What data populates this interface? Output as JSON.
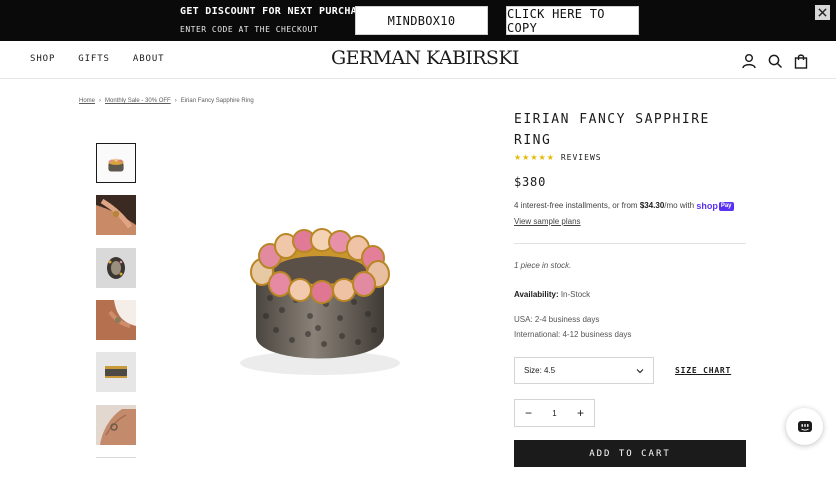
{
  "promo": {
    "title": "GET DISCOUNT FOR NEXT PURCHASE",
    "subtitle": "ENTER CODE AT THE CHECKOUT",
    "code": "MINDBOX10",
    "copy_label": "CLICK HERE TO COPY",
    "close_icon": "close-icon"
  },
  "header": {
    "nav": [
      "SHOP",
      "GIFTS",
      "ABOUT"
    ],
    "logo": "GERMAN KABIRSKI",
    "icons": [
      "account-icon",
      "search-icon",
      "bag-icon"
    ]
  },
  "breadcrumb": {
    "home": "Home",
    "category": "Monthly Sale - 30% OFF",
    "current": "Eirian Fancy Sapphire Ring",
    "separator": "›"
  },
  "thumbnails": [
    "ring-front",
    "hand-ring",
    "ring-top",
    "hand-ring-2",
    "ring-side",
    "hand-ring-3"
  ],
  "product": {
    "title": "EIRIAN FANCY SAPPHIRE RING",
    "stars": "★★★★★",
    "reviews_label": "REVIEWS",
    "price": "$380",
    "installments_prefix": "4 interest-free installments, or from ",
    "installments_amount": "$34.30",
    "installments_suffix": "/mo with ",
    "shop_pay_label": "shop",
    "shop_pay_badge": "Pay",
    "sample_plans": "View sample plans",
    "stock_note": "1 piece in stock.",
    "availability_label": "Availability:",
    "availability_value": " In-Stock",
    "shipping_usa": "USA: 2-4 business days",
    "shipping_intl": "International: 4-12 business days",
    "size_value": "Size: 4.5",
    "size_chart": "SIZE CHART",
    "quantity": "1",
    "qty_minus": "−",
    "qty_plus": "+",
    "add_to_cart": "ADD TO CART"
  },
  "colors": {
    "accent": "#1c1b1b",
    "star": "#e7b800",
    "shop_pay": "#5a31f4",
    "promo_bg": "#0a0a0a"
  }
}
